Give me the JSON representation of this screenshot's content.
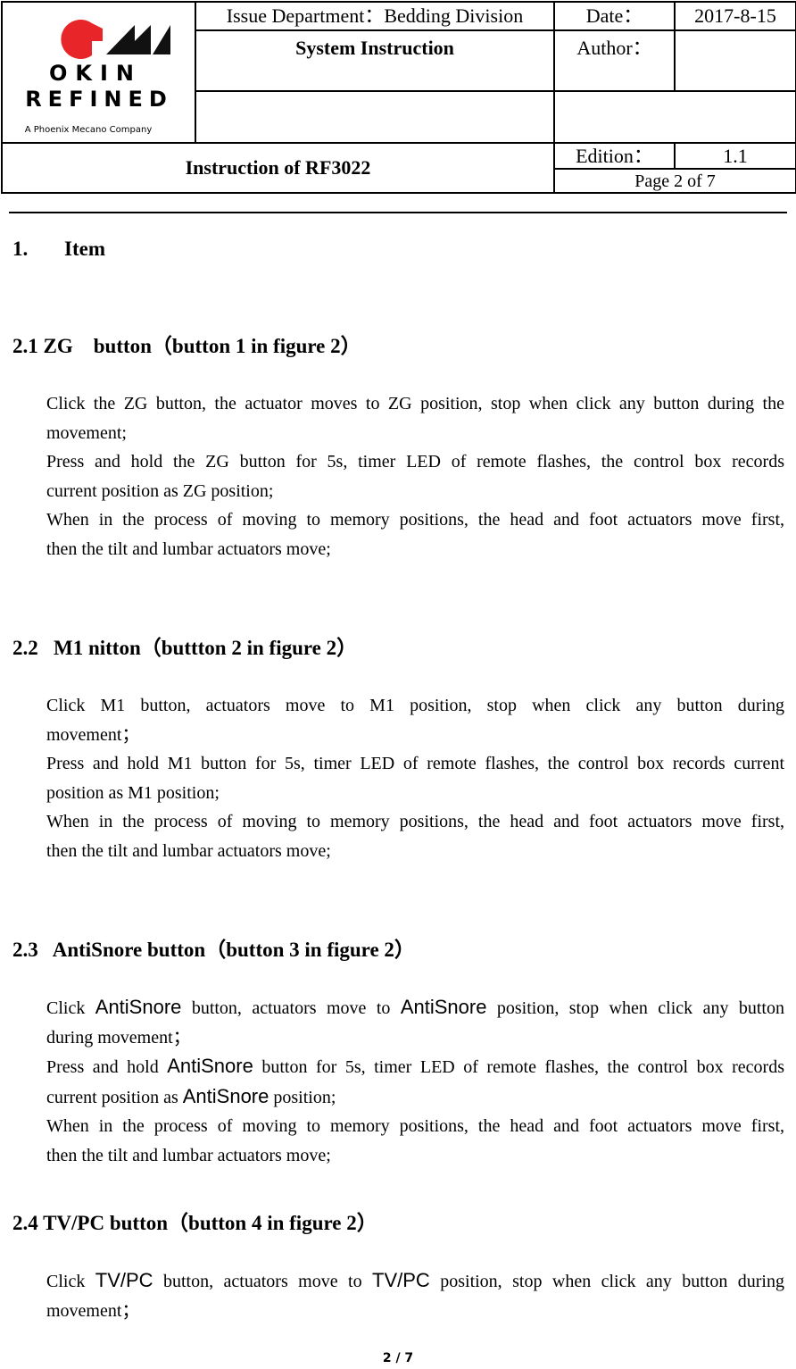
{
  "header": {
    "logo": {
      "brand_line1": "OKIN",
      "brand_line2": "REFINED",
      "tagline": "A Phoenix Mecano Company",
      "colors": {
        "red": "#e8262a",
        "black": "#111111"
      }
    },
    "issue_department": "Issue Department：Bedding Division",
    "date_label": "Date：",
    "date_value": "2017-8-15",
    "system_instruction": "System Instruction",
    "author_label": "Author：",
    "author_value": "",
    "title": "Instruction of RF3022",
    "edition_label": "Edition：",
    "edition_value": "1.1",
    "page_label": "Page 2 of 7"
  },
  "section1": {
    "number": "1.",
    "title": "Item"
  },
  "sections": [
    {
      "heading": "2.1 ZG    button（button 1 in figure 2）",
      "paragraphs": [
        [
          "Click the ZG button, the actuator moves to ZG position, stop when click any button during the",
          "movement;"
        ],
        [
          "Press and hold the ZG button for 5s, timer LED of remote flashes, the control box records",
          "current position as ZG position;"
        ],
        [
          "When in the process of moving to memory positions, the head and foot actuators move first,",
          "then the tilt and lumbar actuators move;"
        ]
      ]
    },
    {
      "heading": "2.2   M1 nitton（buttton 2 in figure 2）",
      "paragraphs": [
        [
          "Click M1 button, actuators move to M1 position, stop when click any button during",
          "movement；"
        ],
        [
          "Press and hold M1 button for 5s, timer LED of remote flashes, the control box records current",
          "position as M1 position;"
        ],
        [
          "When in the process of moving to memory positions, the head and foot actuators move first,",
          "then the tilt and lumbar actuators move;"
        ]
      ]
    },
    {
      "heading": "2.3   AntiSnore button（button 3 in figure 2）",
      "term": "AntiSnore",
      "paragraphs": [
        {
          "l1": [
            "Click ",
            "AntiSnore",
            " button, actuators move to ",
            "AntiSnore",
            " position, stop when click any button"
          ],
          "l2": "during movement；"
        },
        {
          "l1": [
            "Press and hold ",
            "AntiSnore",
            " button for 5s, timer LED of remote flashes, the control box records"
          ],
          "l2a": "current position as ",
          "l2b": "AntiSnore",
          "l2c": " position;"
        },
        {
          "l1": [
            "When in the process of moving to memory positions, the head and foot actuators move first,"
          ],
          "l2": "then the tilt and lumbar actuators move;"
        }
      ]
    },
    {
      "heading": "2.4 TV/PC button（button 4 in figure 2）",
      "paragraphs": [
        {
          "l1": [
            "Click ",
            "TV/PC",
            " button, actuators move to ",
            "TV/PC",
            " position, stop when click any button during"
          ],
          "l2": "movement；"
        }
      ]
    }
  ],
  "footer": {
    "page_indicator": "2 / 7"
  }
}
